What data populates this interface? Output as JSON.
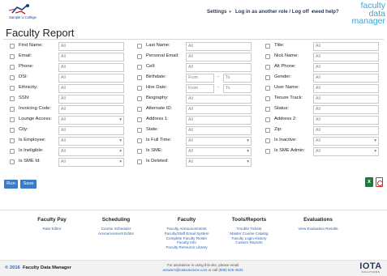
{
  "header": {
    "logo_caption": "Sample U College",
    "nav_settings": "Settings",
    "nav_login": "Log in as another role / Log off",
    "nav_help": "need help?",
    "brand_line1": "faculty data",
    "brand_line2": "manager"
  },
  "page": {
    "title": "Faculty Report"
  },
  "fields": {
    "first_name": {
      "label": "First Name:",
      "value": "All"
    },
    "email": {
      "label": "Email:",
      "value": "All"
    },
    "phone": {
      "label": "Phone:",
      "value": "All"
    },
    "dsi": {
      "label": "DSI:",
      "value": "All"
    },
    "ethnicity": {
      "label": "Ethnicity:",
      "value": "All"
    },
    "ssn": {
      "label": "SSN:",
      "value": "All"
    },
    "invoicing_code": {
      "label": "Invoicing Code:",
      "value": "All"
    },
    "lounge_access": {
      "label": "Lounge Access:",
      "value": "All"
    },
    "city": {
      "label": "City:",
      "value": "All"
    },
    "is_employee": {
      "label": "Is Employee:",
      "value": "All"
    },
    "is_ineligible": {
      "label": "Is Ineligible:",
      "value": "All"
    },
    "is_sme_id": {
      "label": "Is SME Id:",
      "value": "All"
    },
    "last_name": {
      "label": "Last Name:",
      "value": "All"
    },
    "personal_email": {
      "label": "Personal Email:",
      "value": "All"
    },
    "cell": {
      "label": "Cell:",
      "value": "All"
    },
    "birthdate": {
      "label": "Birthdate:",
      "from": "From",
      "to": "To",
      "dash": "-"
    },
    "hire_date": {
      "label": "Hire Date:",
      "from": "From",
      "to": "To",
      "dash": "-"
    },
    "biography": {
      "label": "Biography:",
      "value": "All"
    },
    "alternate_id": {
      "label": "Alternate ID:",
      "value": "All"
    },
    "address1": {
      "label": "Address 1:",
      "value": "All"
    },
    "state": {
      "label": "State:",
      "value": "All"
    },
    "is_full_time": {
      "label": "Is Full Time:",
      "value": "All"
    },
    "is_sme": {
      "label": "Is SME:",
      "value": "All"
    },
    "is_deleted": {
      "label": "Is Deleted:",
      "value": "All"
    },
    "title": {
      "label": "Title:",
      "value": "All"
    },
    "nick_name": {
      "label": "Nick Name:",
      "value": "All"
    },
    "alt_phone": {
      "label": "Alt Phone:",
      "value": "All"
    },
    "gender": {
      "label": "Gender:",
      "value": "All"
    },
    "user_name": {
      "label": "User Name:",
      "value": "All"
    },
    "tenure_track": {
      "label": "Tenure Track:",
      "value": "All"
    },
    "status": {
      "label": "Status:",
      "value": "All"
    },
    "address2": {
      "label": "Address 2:",
      "value": "All"
    },
    "zip": {
      "label": "Zip:",
      "value": "All"
    },
    "is_inactive": {
      "label": "Is Inactive:",
      "value": "All"
    },
    "is_sme_admin": {
      "label": "Is SME Admin:",
      "value": "All"
    }
  },
  "actions": {
    "run": "Run",
    "save": "Save"
  },
  "footer": {
    "faculty_pay": {
      "heading": "Faculty Pay",
      "links": [
        "Rate Editor"
      ]
    },
    "scheduling": {
      "heading": "Scheduling",
      "links": [
        "Course Scheduler",
        "Announcement Editor"
      ]
    },
    "faculty": {
      "heading": "Faculty",
      "links": [
        "Faculty Announcements",
        "Faculty/Staff Email System",
        "Complete Faculty Roster",
        "Faculty Info",
        "Faculty Resource Library"
      ]
    },
    "tools": {
      "heading": "Tools/Reports",
      "links": [
        "Trouble Tickets",
        "Master Course Catalog",
        "Faculty Login History",
        "Custom Reports"
      ]
    },
    "evaluations": {
      "heading": "Evaluations",
      "links": [
        "View Evaluation Results"
      ]
    }
  },
  "bottom": {
    "year": "© 2016",
    "product": "Faculty Data Manager",
    "assist_line1": "For assistance in using this site, please email",
    "assist_email": "answers@iotasolutions.com",
    "assist_mid": " or call ",
    "assist_phone": "(888) 826-4633",
    "iota": "IOTA",
    "iota_sub": "SOLUTIONS"
  },
  "colors": {
    "brand": "#3aa6d6",
    "button": "#3a7bc8",
    "link": "#2b63b5"
  }
}
